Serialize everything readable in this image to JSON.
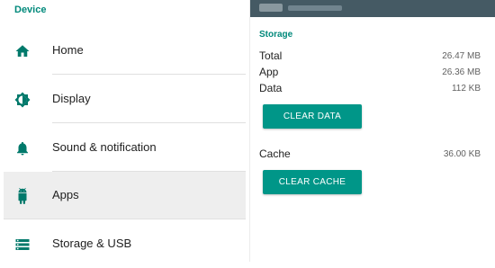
{
  "left_panel": {
    "section_header": "Device",
    "items": [
      {
        "label": "Home",
        "icon": "home-icon"
      },
      {
        "label": "Display",
        "icon": "brightness-icon"
      },
      {
        "label": "Sound & notification",
        "icon": "bell-icon"
      },
      {
        "label": "Apps",
        "icon": "android-icon",
        "selected": true
      },
      {
        "label": "Storage & USB",
        "icon": "storage-icon"
      }
    ]
  },
  "right_panel": {
    "section_header": "Storage",
    "rows": [
      {
        "label": "Total",
        "value": "26.47 MB"
      },
      {
        "label": "App",
        "value": "26.36 MB"
      },
      {
        "label": "Data",
        "value": "112 KB"
      }
    ],
    "clear_data_label": "CLEAR DATA",
    "cache": {
      "label": "Cache",
      "value": "36.00 KB"
    },
    "clear_cache_label": "CLEAR CACHE"
  },
  "colors": {
    "accent": "#00897b",
    "button": "#009688",
    "icon": "#00796b",
    "topbar": "#455a64",
    "selected_bg": "#eeeeee"
  }
}
